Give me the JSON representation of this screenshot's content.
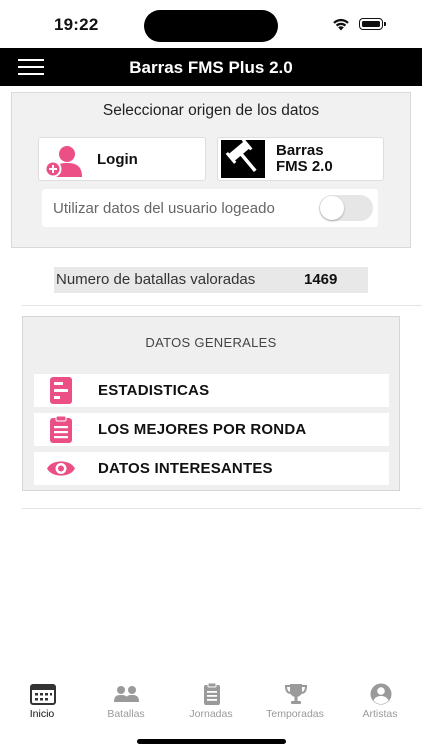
{
  "status_bar": {
    "time": "19:22"
  },
  "app_bar": {
    "title": "Barras FMS Plus 2.0"
  },
  "source_panel": {
    "heading": "Seleccionar origen de los datos",
    "login_label": "Login",
    "barras_label_line1": "Barras",
    "barras_label_line2": "FMS 2.0",
    "toggle_label": "Utilizar datos del usuario logeado",
    "toggle_on": false
  },
  "battles_count": {
    "label": "Numero de batallas valoradas",
    "value": "1469"
  },
  "general": {
    "heading": "DATOS GENERALES",
    "items": [
      {
        "label": "ESTADISTICAS",
        "icon": "chart-list-icon"
      },
      {
        "label": "LOS MEJORES POR RONDA",
        "icon": "clipboard-icon"
      },
      {
        "label": "DATOS INTERESANTES",
        "icon": "eye-icon"
      }
    ]
  },
  "tabs": [
    {
      "label": "Inicio",
      "icon": "calendar-icon",
      "active": true
    },
    {
      "label": "Batallas",
      "icon": "people-icon",
      "active": false
    },
    {
      "label": "Jornadas",
      "icon": "clipboard-list-icon",
      "active": false
    },
    {
      "label": "Temporadas",
      "icon": "trophy-icon",
      "active": false
    },
    {
      "label": "Artistas",
      "icon": "person-circle-icon",
      "active": false
    }
  ],
  "colors": {
    "accent": "#ec4f86",
    "appbar": "#000000",
    "tab_inactive": "#9a9a9a"
  }
}
